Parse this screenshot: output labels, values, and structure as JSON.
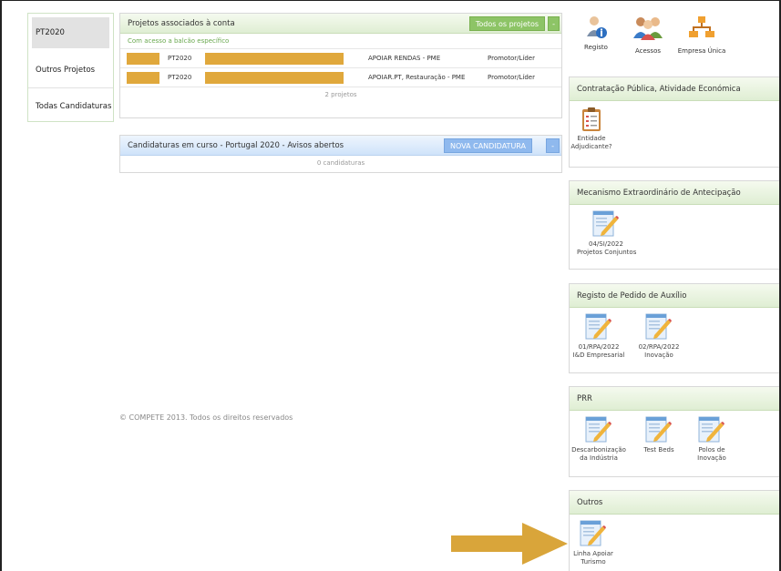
{
  "leftnav": {
    "items": [
      {
        "label": "PT2020"
      },
      {
        "label": "Outros Projetos"
      },
      {
        "label": "Todas Candidaturas"
      }
    ]
  },
  "projects": {
    "title": "Projetos associados à conta",
    "all_button": "Todos os projetos",
    "toggle": "-",
    "subtitle": "Com acesso a balcão específico",
    "rows": [
      {
        "code": "PT2020",
        "measure": "APOIAR RENDAS - PME",
        "role": "Promotor/Líder"
      },
      {
        "code": "PT2020",
        "measure": "APOIAR.PT, Restauração - PME",
        "role": "Promotor/Líder"
      }
    ],
    "count": "2 projetos"
  },
  "applications": {
    "title": "Candidaturas em curso - Portugal 2020 - Avisos abertos",
    "new_button": "NOVA CANDIDATURA",
    "toggle": "-",
    "count": "0 candidaturas"
  },
  "footer": "© COMPETE 2013. Todos os direitos reservados",
  "topicons": [
    {
      "name": "registo-icon",
      "label": "Registo"
    },
    {
      "name": "acessos-icon",
      "label": "Acessos"
    },
    {
      "name": "empresa-unica-icon",
      "label": "Empresa Única"
    }
  ],
  "right_panels": {
    "contratacao": {
      "title": "Contratação Pública, Atividade Económica",
      "tiles": [
        {
          "l1": "Entidade",
          "l2": "Adjudicante?"
        }
      ]
    },
    "mecanismo": {
      "title": "Mecanismo Extraordinário de Antecipação",
      "tiles": [
        {
          "l1": "04/SI/2022",
          "l2": "Projetos Conjuntos"
        }
      ]
    },
    "registo_pedido": {
      "title": "Registo de Pedido de Auxílio",
      "tiles": [
        {
          "l1": "01/RPA/2022",
          "l2": "I&D Empresarial"
        },
        {
          "l1": "02/RPA/2022",
          "l2": "Inovação"
        }
      ]
    },
    "prr": {
      "title": "PRR",
      "tiles": [
        {
          "l1": "Descarbonização",
          "l2": "da Indústria"
        },
        {
          "l1": "Test Beds",
          "l2": ""
        },
        {
          "l1": "Polos de",
          "l2": "Inovação"
        }
      ]
    },
    "outros": {
      "title": "Outros",
      "tiles": [
        {
          "l1": "Linha Apoiar",
          "l2": "Turismo"
        }
      ]
    }
  },
  "colors": {
    "green_button": "#8dc466",
    "blue_button": "#8fb9ee",
    "redaction": "#e0a83c",
    "arrow": "#d9a53a"
  }
}
